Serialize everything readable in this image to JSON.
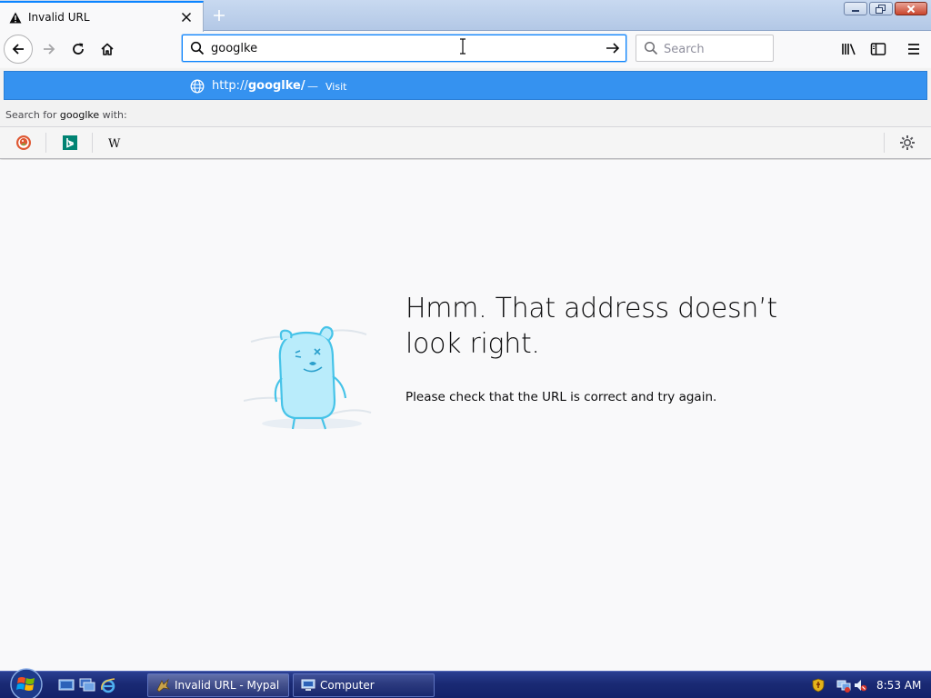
{
  "tab": {
    "title": "Invalid URL",
    "icon": "warning-icon",
    "new_tab_icon": "plus-icon"
  },
  "navbar": {
    "url_value": "googlke",
    "search_placeholder": "Search"
  },
  "autocomplete": {
    "suggestion_url_prefix": "http://",
    "suggestion_url_host": "googlke/",
    "suggestion_separator": "—",
    "suggestion_action": "Visit",
    "search_with_prefix": "Search for ",
    "search_with_term": "googlke",
    "search_with_suffix": " with:",
    "engines": [
      "DuckDuckGo",
      "Bing",
      "Wikipedia"
    ]
  },
  "error_page": {
    "title": "Hmm. That address doesn’t look right.",
    "description": "Please check that the URL is correct and try again."
  },
  "taskbar": {
    "items": [
      {
        "label": "Invalid URL - Mypal"
      },
      {
        "label": "Computer"
      }
    ],
    "clock": "8:53 AM"
  },
  "colors": {
    "accent": "#0a84ff",
    "suggestion_highlight": "#3592f0",
    "taskbar": "#1a2a74"
  }
}
